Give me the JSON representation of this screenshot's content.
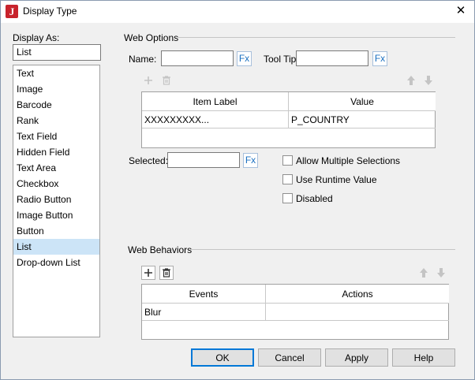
{
  "window": {
    "title": "Display Type",
    "app_icon_letter": "J",
    "close_glyph": "✕"
  },
  "display_as": {
    "label": "Display As:",
    "value": "List",
    "items": [
      "Text",
      "Image",
      "Barcode",
      "Rank",
      "Text Field",
      "Hidden Field",
      "Text Area",
      "Checkbox",
      "Radio Button",
      "Image Button",
      "Button",
      "List",
      "Drop-down List"
    ],
    "selected_index": 11
  },
  "web_options": {
    "title": "Web Options",
    "name_label": "Name:",
    "name_value": "",
    "tooltip_label": "Tool Tip:",
    "tooltip_value": "",
    "fx_label": "Fx",
    "table": {
      "columns": [
        "Item Label",
        "Value"
      ],
      "rows": [
        [
          "XXXXXXXXX...",
          "P_COUNTRY"
        ]
      ]
    },
    "selected_label": "Selected:",
    "selected_value": "",
    "checkboxes": [
      {
        "label": "Allow Multiple Selections",
        "checked": false
      },
      {
        "label": "Use Runtime Value",
        "checked": false
      },
      {
        "label": "Disabled",
        "checked": false
      }
    ]
  },
  "web_behaviors": {
    "title": "Web Behaviors",
    "table": {
      "columns": [
        "Events",
        "Actions"
      ],
      "rows": [
        [
          "Blur",
          ""
        ]
      ]
    }
  },
  "buttons": {
    "ok": "OK",
    "cancel": "Cancel",
    "apply": "Apply",
    "help": "Help"
  },
  "colors": {
    "selection": "#cce4f7",
    "fx_text": "#1a6fc0",
    "app_icon": "#c8232c",
    "default_border": "#0078d7"
  }
}
